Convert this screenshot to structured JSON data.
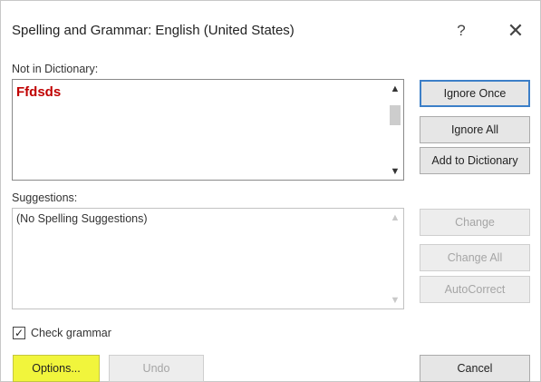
{
  "dialog": {
    "title": "Spelling and Grammar: English (United States)",
    "help_label": "?",
    "close_label": "✕"
  },
  "not_in_dictionary": {
    "label": "Not in Dictionary:",
    "word": "Ffdsds"
  },
  "suggestions": {
    "label": "Suggestions:",
    "items": [
      "(No Spelling Suggestions)"
    ]
  },
  "buttons": {
    "ignore_once": "Ignore Once",
    "ignore_all": "Ignore All",
    "add_to_dictionary": "Add to Dictionary",
    "change": "Change",
    "change_all": "Change All",
    "autocorrect": "AutoCorrect",
    "options": "Options...",
    "undo": "Undo",
    "cancel": "Cancel"
  },
  "check_grammar": {
    "label": "Check grammar",
    "checked": true
  }
}
